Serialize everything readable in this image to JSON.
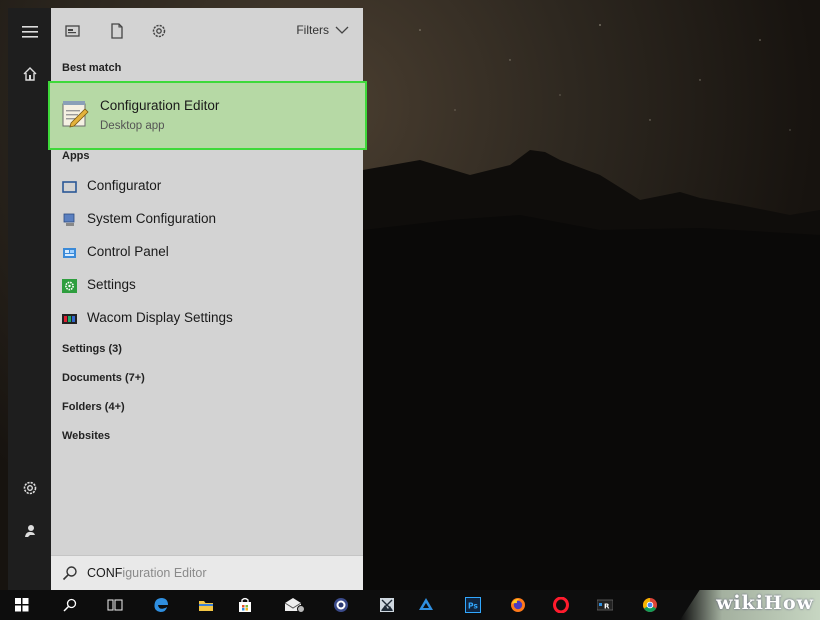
{
  "panel": {
    "filters_label": "Filters",
    "best_match_heading": "Best match",
    "best_match": {
      "title": "Configuration Editor",
      "subtitle": "Desktop app"
    },
    "apps_heading": "Apps",
    "apps": [
      {
        "label": "Configurator",
        "icon": "configurator-icon"
      },
      {
        "label": "System Configuration",
        "icon": "system-configuration-icon"
      },
      {
        "label": "Control Panel",
        "icon": "control-panel-icon"
      },
      {
        "label": "Settings",
        "icon": "settings-app-icon"
      },
      {
        "label": "Wacom Display Settings",
        "icon": "wacom-icon"
      }
    ],
    "categories": [
      "Settings (3)",
      "Documents (7+)",
      "Folders (4+)",
      "Websites"
    ],
    "search": {
      "typed": "CONF",
      "suggestion": "iguration Editor"
    }
  },
  "rail": [
    "hamburger-menu-icon",
    "home-icon",
    "settings-gear-icon",
    "user-icon"
  ],
  "taskbar": [
    "start-icon",
    "search-icon",
    "task-view-icon",
    "edge-icon",
    "file-explorer-icon",
    "store-icon",
    "mail-icon",
    "app-icon",
    "photos-icon",
    "onedrive-icon",
    "photoshop-icon",
    "firefox-icon",
    "opera-icon",
    "app-icon-2",
    "chrome-icon"
  ],
  "watermark": "wikiHow",
  "colors": {
    "highlight_bg": "#b6d9a5",
    "highlight_border": "#3ed93a",
    "panel_bg": "#d3d3d3",
    "rail_bg": "#1e1e1e",
    "taskbar_bg": "#0d0d0d"
  }
}
